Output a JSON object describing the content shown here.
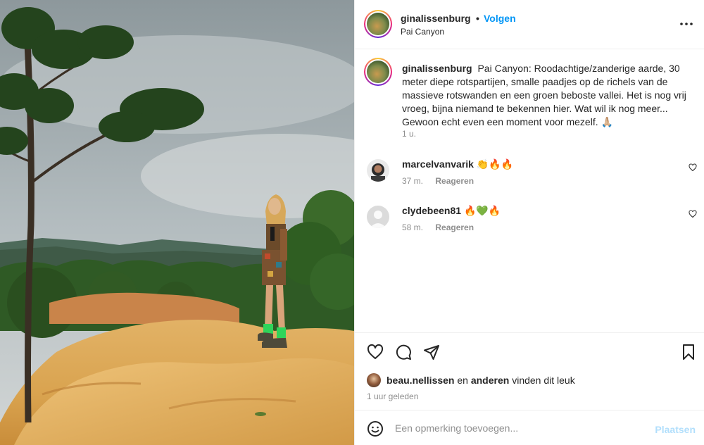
{
  "post": {
    "username": "ginalissenburg",
    "follow_label": "Volgen",
    "separator": "•",
    "location": "Pai Canyon"
  },
  "caption": {
    "username": "ginalissenburg",
    "text": "Pai Canyon: Roodachtige/zanderige aarde, 30 meter diepe rotspartijen, smalle paadjes op de richels van de massieve rotswanden en een groen beboste vallei. Het is nog vrij vroeg, bijna niemand te bekennen hier. Wat wil ik nog meer... Gewoon echt even een moment voor mezelf. 🙏🏼",
    "time": "1 u."
  },
  "comments": [
    {
      "username": "marcelvanvarik",
      "text": "👏🔥🔥",
      "time": "37 m.",
      "reply_label": "Reageren"
    },
    {
      "username": "clydebeen81",
      "text": "🔥💚🔥",
      "time": "58 m.",
      "reply_label": "Reageren"
    }
  ],
  "likes": {
    "user": "beau.nellissen",
    "conjunction": "en",
    "others": "anderen",
    "suffix": "vinden dit leuk"
  },
  "posted_ago": "1 uur geleden",
  "composer": {
    "placeholder": "Een opmerking toevoegen...",
    "post_label": "Plaatsen"
  },
  "icons": {
    "more": "more-horizontal-icon",
    "like": "heart-icon",
    "comment": "comment-icon",
    "share": "send-icon",
    "save": "bookmark-icon",
    "emoji": "emoji-icon"
  },
  "colors": {
    "accent": "#0095f6",
    "post_disabled": "#b2dffc",
    "muted": "#8e8e8e",
    "text": "#262626"
  }
}
